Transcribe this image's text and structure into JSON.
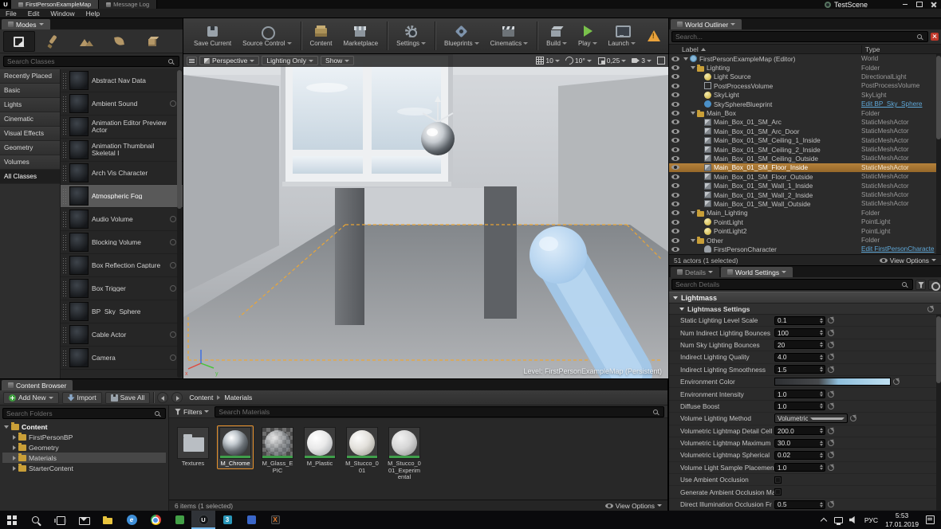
{
  "window": {
    "logo": "U",
    "title": "TestScene",
    "tabs": [
      {
        "label": "FirstPersonExampleMap",
        "active": true
      },
      {
        "label": "Message Log",
        "active": false
      }
    ],
    "menu": [
      {
        "label": "File"
      },
      {
        "label": "Edit"
      },
      {
        "label": "Window"
      },
      {
        "label": "Help"
      }
    ]
  },
  "modes_panel": {
    "tab_label": "Modes",
    "modes": [
      {
        "name": "place-mode",
        "active": true
      },
      {
        "name": "paint-mode",
        "active": false
      },
      {
        "name": "landscape-mode",
        "active": false
      },
      {
        "name": "foliage-mode",
        "active": false
      },
      {
        "name": "geometry-mode",
        "active": false
      }
    ],
    "search_placeholder": "Search Classes",
    "categories": [
      {
        "label": "Recently Placed"
      },
      {
        "label": "Basic"
      },
      {
        "label": "Lights"
      },
      {
        "label": "Cinematic"
      },
      {
        "label": "Visual Effects"
      },
      {
        "label": "Geometry"
      },
      {
        "label": "Volumes"
      },
      {
        "label": "All Classes",
        "active": true
      }
    ],
    "actors": [
      {
        "label": "Abstract Nav Data",
        "icon": "nav-data-icon"
      },
      {
        "label": "Ambient Sound",
        "icon": "speaker-icon",
        "badge": true
      },
      {
        "label": "Animation Editor Preview Actor",
        "icon": "animation-icon"
      },
      {
        "label": "Animation Thumbnail Skeletal I",
        "icon": "skeletal-icon"
      },
      {
        "label": "Arch Vis Character",
        "icon": "character-icon"
      },
      {
        "label": "Atmospheric Fog",
        "icon": "fog-icon",
        "selected": true
      },
      {
        "label": "Audio Volume",
        "icon": "audio-volume-icon",
        "badge": true
      },
      {
        "label": "Blocking Volume",
        "icon": "blocking-volume-icon",
        "badge": true
      },
      {
        "label": "Box Reflection Capture",
        "icon": "reflection-icon",
        "badge": true
      },
      {
        "label": "Box Trigger",
        "icon": "trigger-icon",
        "badge": true
      },
      {
        "label": "BP_Sky_Sphere",
        "icon": "sky-sphere-icon"
      },
      {
        "label": "Cable Actor",
        "icon": "cable-icon",
        "badge": true
      },
      {
        "label": "Camera",
        "icon": "camera-icon",
        "badge": true
      }
    ]
  },
  "toolbar": {
    "buttons": [
      {
        "label": "Save Current",
        "icon": "save-icon"
      },
      {
        "label": "Source Control",
        "icon": "source-control-icon",
        "dropdown": true,
        "sep_after": true
      },
      {
        "label": "Content",
        "icon": "content-icon"
      },
      {
        "label": "Marketplace",
        "icon": "marketplace-icon",
        "sep_after": true
      },
      {
        "label": "Settings",
        "icon": "settings-icon",
        "dropdown": true,
        "sep_after": true
      },
      {
        "label": "Blueprints",
        "icon": "blueprints-icon",
        "dropdown": true
      },
      {
        "label": "Cinematics",
        "icon": "cinematics-icon",
        "dropdown": true,
        "sep_after": true
      },
      {
        "label": "Build",
        "icon": "build-icon",
        "dropdown": true
      },
      {
        "label": "Play",
        "icon": "play-icon",
        "dropdown": true
      },
      {
        "label": "Launch",
        "icon": "launch-icon",
        "dropdown": true
      }
    ],
    "warning_badge": "!"
  },
  "viewport": {
    "buttons": [
      {
        "label": "Perspective",
        "icon": true
      },
      {
        "label": "Lighting Only"
      },
      {
        "label": "Show"
      }
    ],
    "stats": [
      {
        "icon": "grid-snap-icon",
        "value": "10"
      },
      {
        "icon": "rotation-snap-icon",
        "value": "10°"
      },
      {
        "icon": "scale-snap-icon",
        "value": "0,25"
      },
      {
        "icon": "camera-speed-icon",
        "value": "3"
      }
    ],
    "level_label": "Level:  FirstPersonExampleMap (Persistent)"
  },
  "outliner": {
    "title": "World Outliner",
    "search_placeholder": "Search...",
    "columns": {
      "label": "Label",
      "type": "Type"
    },
    "rows": [
      {
        "label": "FirstPersonExampleMap (Editor)",
        "type": "World",
        "indent": 0,
        "kind": "world",
        "expandable": true
      },
      {
        "label": "Lighting",
        "type": "Folder",
        "indent": 1,
        "kind": "folder",
        "expandable": true
      },
      {
        "label": "Light Source",
        "type": "DirectionalLight",
        "indent": 2,
        "kind": "light"
      },
      {
        "label": "PostProcessVolume",
        "type": "PostProcessVolume",
        "indent": 2,
        "kind": "volume"
      },
      {
        "label": "SkyLight",
        "type": "SkyLight",
        "indent": 2,
        "kind": "light"
      },
      {
        "label": "SkySphereBlueprint",
        "type": "Edit BP_Sky_Sphere",
        "indent": 2,
        "kind": "bp",
        "type_link": true
      },
      {
        "label": "Main_Box",
        "type": "Folder",
        "indent": 1,
        "kind": "folder",
        "expandable": true
      },
      {
        "label": "Main_Box_01_SM_Arc",
        "type": "StaticMeshActor",
        "indent": 2,
        "kind": "mesh"
      },
      {
        "label": "Main_Box_01_SM_Arc_Door",
        "type": "StaticMeshActor",
        "indent": 2,
        "kind": "mesh"
      },
      {
        "label": "Main_Box_01_SM_Ceiling_1_Inside",
        "type": "StaticMeshActor",
        "indent": 2,
        "kind": "mesh"
      },
      {
        "label": "Main_Box_01_SM_Ceiling_2_Inside",
        "type": "StaticMeshActor",
        "indent": 2,
        "kind": "mesh"
      },
      {
        "label": "Main_Box_01_SM_Ceiling_Outside",
        "type": "StaticMeshActor",
        "indent": 2,
        "kind": "mesh"
      },
      {
        "label": "Main_Box_01_SM_Floor_Inside",
        "type": "StaticMeshActor",
        "indent": 2,
        "kind": "mesh",
        "selected": true
      },
      {
        "label": "Main_Box_01_SM_Floor_Outside",
        "type": "StaticMeshActor",
        "indent": 2,
        "kind": "mesh"
      },
      {
        "label": "Main_Box_01_SM_Wall_1_Inside",
        "type": "StaticMeshActor",
        "indent": 2,
        "kind": "mesh"
      },
      {
        "label": "Main_Box_01_SM_Wall_2_Inside",
        "type": "StaticMeshActor",
        "indent": 2,
        "kind": "mesh"
      },
      {
        "label": "Main_Box_01_SM_Wall_Outside",
        "type": "StaticMeshActor",
        "indent": 2,
        "kind": "mesh"
      },
      {
        "label": "Main_Lighting",
        "type": "Folder",
        "indent": 1,
        "kind": "folder",
        "expandable": true
      },
      {
        "label": "PointLight",
        "type": "PointLight",
        "indent": 2,
        "kind": "light"
      },
      {
        "label": "PointLight2",
        "type": "PointLight",
        "indent": 2,
        "kind": "light"
      },
      {
        "label": "Other",
        "type": "Folder",
        "indent": 1,
        "kind": "folder",
        "expandable": true
      },
      {
        "label": "FirstPersonCharacter",
        "type": "Edit FirstPersonCharacte",
        "indent": 2,
        "kind": "char",
        "type_link": true
      }
    ],
    "status": "51 actors (1 selected)",
    "view_options_label": "View Options"
  },
  "details": {
    "tabs": [
      {
        "label": "Details",
        "active": false
      },
      {
        "label": "World Settings",
        "active": true
      }
    ],
    "search_placeholder": "Search Details",
    "section": "Lightmass",
    "subsection": "Lightmass Settings",
    "properties": [
      {
        "label": "Static Lighting Level Scale",
        "value": "0.1",
        "control": "spin"
      },
      {
        "label": "Num Indirect Lighting Bounces",
        "value": "100",
        "control": "spin"
      },
      {
        "label": "Num Sky Lighting Bounces",
        "value": "20",
        "control": "spin"
      },
      {
        "label": "Indirect Lighting Quality",
        "value": "4.0",
        "control": "spin"
      },
      {
        "label": "Indirect Lighting Smoothness",
        "value": "1.5",
        "control": "spin"
      },
      {
        "label": "Environment Color",
        "value": "",
        "control": "color",
        "expandable": true
      },
      {
        "label": "Environment Intensity",
        "value": "1.0",
        "control": "spin"
      },
      {
        "label": "Diffuse Boost",
        "value": "1.0",
        "control": "spin"
      },
      {
        "label": "Volume Lighting Method",
        "value": "Volumetric Lightmap",
        "control": "dropdown"
      },
      {
        "label": "Volumetric Lightmap Detail Cell",
        "value": "200.0",
        "control": "spin"
      },
      {
        "label": "Volumetric Lightmap Maximum",
        "value": "30.0",
        "control": "spin"
      },
      {
        "label": "Volumetric Lightmap Spherical",
        "value": "0.02",
        "control": "spin"
      },
      {
        "label": "Volume Light Sample Placemen",
        "value": "1.0",
        "control": "spin"
      },
      {
        "label": "Use Ambient Occlusion",
        "value": "",
        "control": "checkbox"
      },
      {
        "label": "Generate Ambient Occlusion Ma",
        "value": "",
        "control": "checkbox"
      },
      {
        "label": "Direct Illumination Occlusion Fr",
        "value": "0.5",
        "control": "spin"
      }
    ]
  },
  "content_browser": {
    "tab_label": "Content Browser",
    "add_new_label": "Add New",
    "import_label": "Import",
    "save_all_label": "Save All",
    "breadcrumb": [
      {
        "label": "Content"
      },
      {
        "label": "Materials",
        "sep": true
      }
    ],
    "search_folders_placeholder": "Search Folders",
    "filters_label": "Filters",
    "search_assets_placeholder": "Search Materials",
    "folders": [
      {
        "label": "Content",
        "indent": 0,
        "root": true,
        "expanded": true
      },
      {
        "label": "FirstPersonBP",
        "indent": 1
      },
      {
        "label": "Geometry",
        "indent": 1
      },
      {
        "label": "Materials",
        "indent": 1,
        "selected": true
      },
      {
        "label": "StarterContent",
        "indent": 1
      }
    ],
    "assets": [
      {
        "label": "Textures",
        "kind": "folder",
        "thumb": "folder-thumb"
      },
      {
        "label": "M_Chrome",
        "kind": "material",
        "thumb": "chrome-sphere-thumb",
        "selected": true
      },
      {
        "label": "M_Glass_EPIC",
        "kind": "material",
        "thumb": "glass-sphere-thumb"
      },
      {
        "label": "M_Plastic",
        "kind": "material",
        "thumb": "plastic-sphere-thumb"
      },
      {
        "label": "M_Stucco_001",
        "kind": "material",
        "thumb": "stucco-sphere-thumb"
      },
      {
        "label": "M_Stucco_001_Experimental",
        "kind": "material",
        "thumb": "stucco2-sphere-thumb"
      }
    ],
    "status": "6 items (1 selected)",
    "view_options_label": "View Options"
  },
  "taskbar": {
    "icons": [
      {
        "name": "start-icon"
      },
      {
        "name": "search-icon"
      },
      {
        "name": "task-view-icon"
      },
      {
        "name": "mail-icon"
      },
      {
        "name": "explorer-icon"
      },
      {
        "name": "edge-icon",
        "label": "e"
      },
      {
        "name": "chrome-icon"
      },
      {
        "name": "app-green-icon"
      },
      {
        "name": "ue-taskbar-icon",
        "label": "U",
        "active": true
      },
      {
        "name": "app-3ds-icon",
        "label": "3"
      },
      {
        "name": "app-blue-icon"
      },
      {
        "name": "app-orange-icon",
        "label": "X"
      }
    ],
    "tray": {
      "lang": "РУС",
      "time": "5:53",
      "date": "17.01.2019"
    }
  }
}
